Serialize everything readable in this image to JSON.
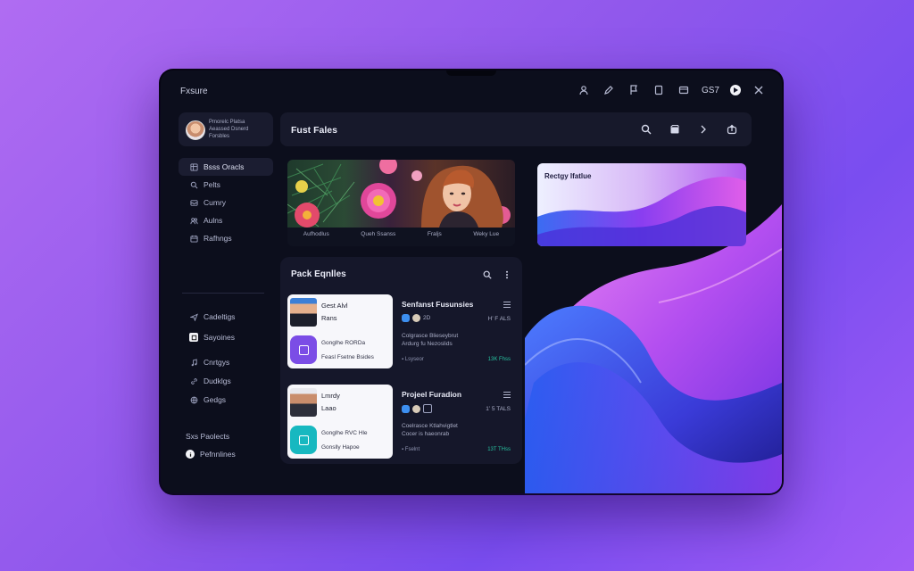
{
  "window": {
    "title": "Fxsure",
    "clock": "GS7"
  },
  "top_icons": [
    "user-icon",
    "pen-icon",
    "flag-icon",
    "file-icon",
    "window-icon",
    "play-icon",
    "close-icon"
  ],
  "profile": {
    "line1": "Pmorelc Platsa",
    "line2": "Aeassed Dsnerd",
    "line3": "Forsbles"
  },
  "sidebar": {
    "primary": [
      {
        "label": "Bsss Oracls",
        "icon": "grid-icon",
        "active": true
      },
      {
        "label": "Pelts",
        "icon": "search-icon"
      },
      {
        "label": "Cumry",
        "icon": "inbox-icon"
      },
      {
        "label": "Aulns",
        "icon": "users-icon"
      },
      {
        "label": "Rafhngs",
        "icon": "calendar-icon"
      }
    ],
    "secondary": [
      {
        "label": "Cadeltigs",
        "icon": "send-icon"
      },
      {
        "label": "Sayoines",
        "icon": "app-icon"
      },
      {
        "label": "Cnrtgys",
        "icon": "music-icon"
      },
      {
        "label": "Dudklgs",
        "icon": "link-icon"
      },
      {
        "label": "Gedgs",
        "icon": "globe-icon"
      }
    ],
    "footer": [
      {
        "label": "Sxs Paolects",
        "icon": ""
      },
      {
        "label": "Pefnnlines",
        "icon": "info-icon"
      }
    ]
  },
  "header": {
    "title": "Fust Fales"
  },
  "banner": {
    "labels": [
      "Aufhodlus",
      "Queh Ssanss",
      "Fraljs",
      "Weky Lue"
    ]
  },
  "pack": {
    "title": "Pack Eqnlles",
    "items": [
      {
        "person_name": "Gest Alvl",
        "person_sub": "Rans",
        "line1": "Gonglhe RORDa",
        "line2": "Feasl Fsetne Bsides",
        "title": "Senfanst Fusunsies",
        "chip_text": "2D",
        "stat": "H’ F ALS",
        "desc1": "Colgrasce Blieseybrut",
        "desc2": "Ardurg fu Nezoslids",
        "foot_left": "Lsyseor",
        "foot_right": "13K Fhss",
        "accent": "#7b4de6"
      },
      {
        "person_name": "Lmrdy",
        "person_sub": "Laao",
        "line1": "Gonglhe RVC Hle",
        "line2": "Gonslly Hapoe",
        "title": "Projeel Furadion",
        "chip_text": "",
        "stat": "1’ 5 TALS",
        "desc1": "Coelrasce Ktlahvigtlet",
        "desc2": "Cocer is haeonrab",
        "foot_left": "Fselnt",
        "foot_right": "13T THss",
        "accent": "#17b8c0"
      }
    ]
  },
  "preview": {
    "title": "Rectgy Ifatlue"
  },
  "colors": {
    "background": "#9a5ff0",
    "device": "#0c0e1c",
    "panel": "#17192b",
    "accent_purple": "#7b4de6",
    "accent_teal": "#17b8c0",
    "accent_green": "#27c2a0"
  }
}
